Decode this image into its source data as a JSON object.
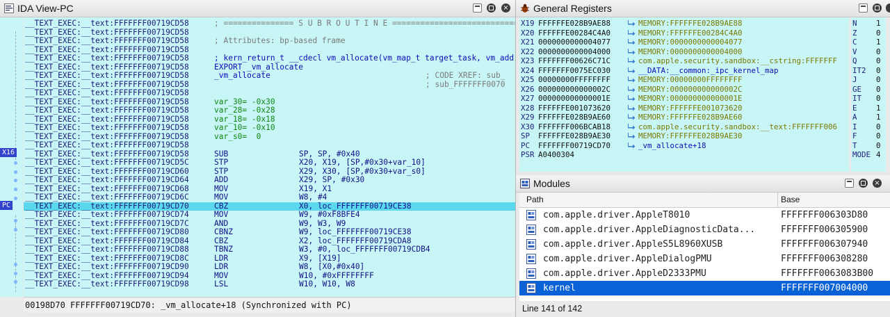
{
  "ida": {
    "title": "IDA View-PC",
    "status": "00198D70 FFFFFFF00719CD70: _vm_allocate+18 (Synchronized with PC)",
    "gutter_tags": [
      "X16",
      "PC"
    ],
    "lines": [
      {
        "addr": "__TEXT_EXEC:__text:FFFFFFF00719CD58",
        "kind": "cmt",
        "text": "; =============== S U B R O U T I N E ======================================="
      },
      {
        "addr": "__TEXT_EXEC:__text:FFFFFFF00719CD58",
        "kind": "blank",
        "text": ""
      },
      {
        "addr": "__TEXT_EXEC:__text:FFFFFFF00719CD58",
        "kind": "cmt",
        "text": "; Attributes: bp-based frame"
      },
      {
        "addr": "__TEXT_EXEC:__text:FFFFFFF00719CD58",
        "kind": "blank",
        "text": ""
      },
      {
        "addr": "__TEXT_EXEC:__text:FFFFFFF00719CD58",
        "kind": "dir",
        "text": "; kern_return_t __cdecl vm_allocate(vm_map_t target_task, vm_address_t *address,"
      },
      {
        "addr": "__TEXT_EXEC:__text:FFFFFFF00719CD58",
        "kind": "dir",
        "text": "EXPORT _vm_allocate"
      },
      {
        "addr": "__TEXT_EXEC:__text:FFFFFFF00719CD58",
        "kind": "fn",
        "text": "_vm_allocate",
        "xref": "; CODE XREF: sub_"
      },
      {
        "addr": "__TEXT_EXEC:__text:FFFFFFF00719CD58",
        "kind": "xrefonly",
        "text": "",
        "xref": "; sub_FFFFFFF0070"
      },
      {
        "addr": "__TEXT_EXEC:__text:FFFFFFF00719CD58",
        "kind": "blank",
        "text": ""
      },
      {
        "addr": "__TEXT_EXEC:__text:FFFFFFF00719CD58",
        "kind": "var",
        "text": "var_30= -0x30"
      },
      {
        "addr": "__TEXT_EXEC:__text:FFFFFFF00719CD58",
        "kind": "var",
        "text": "var_28= -0x28"
      },
      {
        "addr": "__TEXT_EXEC:__text:FFFFFFF00719CD58",
        "kind": "var",
        "text": "var_18= -0x18"
      },
      {
        "addr": "__TEXT_EXEC:__text:FFFFFFF00719CD58",
        "kind": "var",
        "text": "var_10= -0x10"
      },
      {
        "addr": "__TEXT_EXEC:__text:FFFFFFF00719CD58",
        "kind": "var",
        "text": "var_s0=  0"
      },
      {
        "addr": "__TEXT_EXEC:__text:FFFFFFF00719CD58",
        "kind": "blank",
        "text": ""
      },
      {
        "addr": "__TEXT_EXEC:__text:FFFFFFF00719CD58",
        "kind": "ins",
        "mn": "SUB",
        "ops": "SP, SP, #0x40"
      },
      {
        "addr": "__TEXT_EXEC:__text:FFFFFFF00719CD5C",
        "kind": "ins",
        "mn": "STP",
        "ops": "X20, X19, [SP,#0x30+var_10]"
      },
      {
        "addr": "__TEXT_EXEC:__text:FFFFFFF00719CD60",
        "kind": "ins",
        "mn": "STP",
        "ops": "X29, X30, [SP,#0x30+var_s0]"
      },
      {
        "addr": "__TEXT_EXEC:__text:FFFFFFF00719CD64",
        "kind": "ins",
        "mn": "ADD",
        "ops": "X29, SP, #0x30"
      },
      {
        "addr": "__TEXT_EXEC:__text:FFFFFFF00719CD68",
        "kind": "ins",
        "mn": "MOV",
        "ops": "X19, X1"
      },
      {
        "addr": "__TEXT_EXEC:__text:FFFFFFF00719CD6C",
        "kind": "ins",
        "mn": "MOV",
        "ops": "W8, #4"
      },
      {
        "addr": "__TEXT_EXEC:__text:FFFFFFF00719CD70",
        "kind": "ins",
        "mn": "CBZ",
        "ops": "X0, loc_FFFFFFF00719CE38",
        "hl": true
      },
      {
        "addr": "__TEXT_EXEC:__text:FFFFFFF00719CD74",
        "kind": "ins",
        "mn": "MOV",
        "ops": "W9, #0xF8BFE4"
      },
      {
        "addr": "__TEXT_EXEC:__text:FFFFFFF00719CD7C",
        "kind": "ins",
        "mn": "AND",
        "ops": "W9, W3, W9"
      },
      {
        "addr": "__TEXT_EXEC:__text:FFFFFFF00719CD80",
        "kind": "ins",
        "mn": "CBNZ",
        "ops": "W9, loc_FFFFFFF00719CE38"
      },
      {
        "addr": "__TEXT_EXEC:__text:FFFFFFF00719CD84",
        "kind": "ins",
        "mn": "CBZ",
        "ops": "X2, loc_FFFFFFF00719CDA8"
      },
      {
        "addr": "__TEXT_EXEC:__text:FFFFFFF00719CD88",
        "kind": "ins",
        "mn": "TBNZ",
        "ops": "W3, #0, loc_FFFFFFF00719CDB4"
      },
      {
        "addr": "__TEXT_EXEC:__text:FFFFFFF00719CD8C",
        "kind": "ins",
        "mn": "LDR",
        "ops": "X9, [X19]"
      },
      {
        "addr": "__TEXT_EXEC:__text:FFFFFFF00719CD90",
        "kind": "ins",
        "mn": "LDR",
        "ops": "W8, [X0,#0x40]"
      },
      {
        "addr": "__TEXT_EXEC:__text:FFFFFFF00719CD94",
        "kind": "ins",
        "mn": "MOV",
        "ops": "W10, #0xFFFFFFFF"
      },
      {
        "addr": "__TEXT_EXEC:__text:FFFFFFF00719CD98",
        "kind": "ins",
        "mn": "LSL",
        "ops": "W10, W10, W8"
      }
    ]
  },
  "registers": {
    "title": "General Registers",
    "rows": [
      {
        "name": "X19",
        "value": "FFFFFFE028B9AE88",
        "target": "MEMORY:FFFFFFE028B9AE88",
        "type": "mem"
      },
      {
        "name": "X20",
        "value": "FFFFFFE00284C4A0",
        "target": "MEMORY:FFFFFFE00284C4A0",
        "type": "mem"
      },
      {
        "name": "X21",
        "value": "0000000000004077",
        "target": "MEMORY:0000000000004077",
        "type": "mem"
      },
      {
        "name": "X22",
        "value": "0000000000004000",
        "target": "MEMORY:0000000000004000",
        "type": "mem"
      },
      {
        "name": "X23",
        "value": "FFFFFFF00626C71C",
        "target": "com.apple.security.sandbox:__cstring:FFFFFFF",
        "type": "mem"
      },
      {
        "name": "X24",
        "value": "FFFFFFF0075EC030",
        "target": "__DATA:__common:_ipc_kernel_map",
        "type": "code"
      },
      {
        "name": "X25",
        "value": "00000000FFFFFFFF",
        "target": "MEMORY:00000000FFFFFFFF",
        "type": "mem"
      },
      {
        "name": "X26",
        "value": "000000000000002C",
        "target": "MEMORY:000000000000002C",
        "type": "mem"
      },
      {
        "name": "X27",
        "value": "000000000000001E",
        "target": "MEMORY:000000000000001E",
        "type": "mem"
      },
      {
        "name": "X28",
        "value": "FFFFFFE001073620",
        "target": "MEMORY:FFFFFFE001073620",
        "type": "mem"
      },
      {
        "name": "X29",
        "value": "FFFFFFE028B9AE60",
        "target": "MEMORY:FFFFFFE028B9AE60",
        "type": "mem"
      },
      {
        "name": "X30",
        "value": "FFFFFFF006BCAB18",
        "target": "com.apple.security.sandbox:__text:FFFFFFF006",
        "type": "mem"
      },
      {
        "name": "SP",
        "value": "FFFFFFE028B9AE30",
        "target": "MEMORY:FFFFFFE028B9AE30",
        "type": "mem"
      },
      {
        "name": "PC",
        "value": "FFFFFFF00719CD70",
        "target": "_vm_allocate+18",
        "type": "code"
      },
      {
        "name": "PSR",
        "value": "A0400304",
        "target": "",
        "type": "none"
      }
    ],
    "flags": [
      {
        "name": "N",
        "value": "1"
      },
      {
        "name": "Z",
        "value": "0"
      },
      {
        "name": "C",
        "value": "1"
      },
      {
        "name": "V",
        "value": "0"
      },
      {
        "name": "Q",
        "value": "0"
      },
      {
        "name": "IT2",
        "value": "0"
      },
      {
        "name": "J",
        "value": "0"
      },
      {
        "name": "GE",
        "value": "0"
      },
      {
        "name": "IT",
        "value": "0"
      },
      {
        "name": "E",
        "value": "1"
      },
      {
        "name": "A",
        "value": "1"
      },
      {
        "name": "I",
        "value": "0"
      },
      {
        "name": "F",
        "value": "0"
      },
      {
        "name": "T",
        "value": "0"
      },
      {
        "name": "MODE",
        "value": "4"
      }
    ]
  },
  "modules": {
    "title": "Modules",
    "col_path": "Path",
    "col_base": "Base",
    "rows": [
      {
        "path": "com.apple.driver.AppleT8010",
        "base": "FFFFFFF006303D80"
      },
      {
        "path": "com.apple.driver.AppleDiagnosticData...",
        "base": "FFFFFFF006305900"
      },
      {
        "path": "com.apple.driver.AppleS5L8960XUSB",
        "base": "FFFFFFF006307940"
      },
      {
        "path": "com.apple.driver.AppleDialogPMU",
        "base": "FFFFFFF006308280"
      },
      {
        "path": "com.apple.driver.AppleD2333PMU",
        "base": "FFFFFFF0063083B00"
      },
      {
        "path": "kernel",
        "base": "FFFFFFF007004000",
        "selected": true
      }
    ],
    "status": "Line 141 of 142"
  },
  "colors": {
    "code_bg": "#c8f5f5",
    "highlight": "#5bd7ee",
    "selected_row": "#0b62d6"
  }
}
